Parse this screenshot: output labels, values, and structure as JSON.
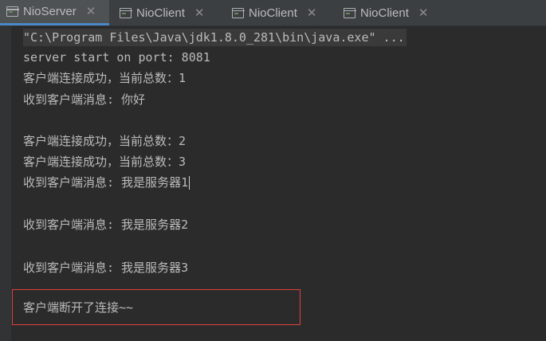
{
  "tabs": [
    {
      "label": "NioServer",
      "close": "✕",
      "active": true
    },
    {
      "label": "NioClient",
      "close": "✕",
      "active": false
    },
    {
      "label": "NioClient",
      "close": "✕",
      "active": false
    },
    {
      "label": "NioClient",
      "close": "✕",
      "active": false
    }
  ],
  "console": {
    "command": "\"C:\\Program Files\\Java\\jdk1.8.0_281\\bin\\java.exe\" ...",
    "lines": [
      "server start on port: 8081",
      "客户端连接成功，当前总数：1",
      "收到客户端消息: 你好",
      "客户端连接成功，当前总数：2",
      "客户端连接成功，当前总数：3",
      "收到客户端消息: 我是服务器1",
      "收到客户端消息: 我是服务器2",
      "收到客户端消息: 我是服务器3",
      "客户端断开了连接~~"
    ]
  },
  "colors": {
    "background": "#2b2b2b",
    "text": "#bbbbbb",
    "highlight_border": "#e0403c",
    "active_tab_underline": "#4a88c7"
  }
}
